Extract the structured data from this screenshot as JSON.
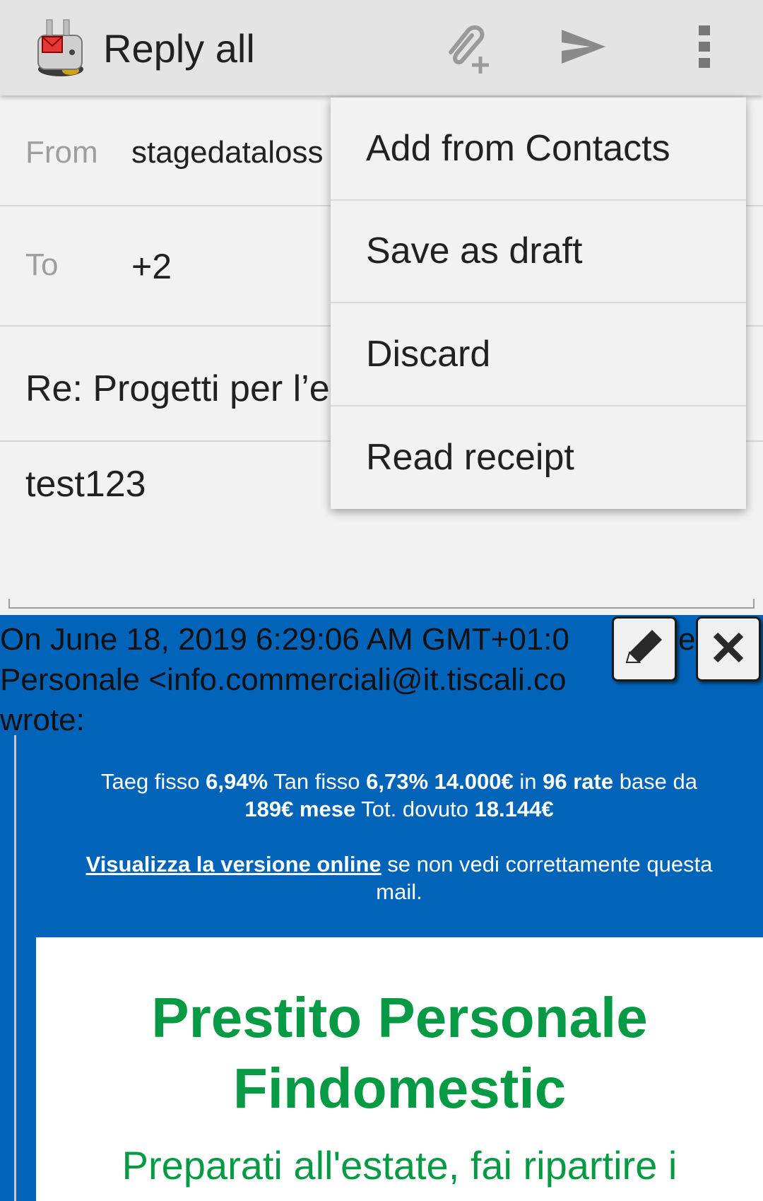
{
  "toolbar": {
    "title": "Reply all",
    "icons": {
      "app": "app-icon",
      "attach": "attach-file-icon",
      "send": "send-icon",
      "more": "more-vert-icon"
    }
  },
  "compose": {
    "from_label": "From",
    "from_value": "stagedataloss",
    "to_label": "To",
    "to_value": "+2",
    "subject": "Re: Progetti per l’e",
    "body": "test123"
  },
  "menu": {
    "items": [
      "Add from Contacts",
      "Save as draft",
      "Discard",
      "Read receipt"
    ]
  },
  "quoted": {
    "header_lines": [
      "On June 18, 2019 6:29:06 AM GMT+01:0",
      "Personale <info.commerciali@it.tiscali.co",
      "wrote:"
    ],
    "header_tail": "e",
    "promo": {
      "taeg_label": "Taeg fisso",
      "taeg_value": "6,94%",
      "tan_label": "Tan fisso",
      "tan_value": "6,73%",
      "amount": "14.000€",
      "in_word": "in",
      "rate": "96 rate",
      "base_text": "base da",
      "monthly": "189€ mese",
      "total_label": "Tot. dovuto",
      "total_value": "18.144€"
    },
    "online_link": "Visualizza la versione online",
    "online_rest": "se non vedi correttamente questa mail.",
    "card_title_line1": "Prestito Personale",
    "card_title_line2": "Findomestic",
    "card_subtitle": "Preparati all'estate, fai ripartire i"
  },
  "float_buttons": {
    "edit": "pencil-icon",
    "close": "close-icon"
  },
  "colors": {
    "quoted_bg": "#0264b8",
    "brand_green": "#079a44",
    "toolbar_bg": "#e4e4e4"
  }
}
